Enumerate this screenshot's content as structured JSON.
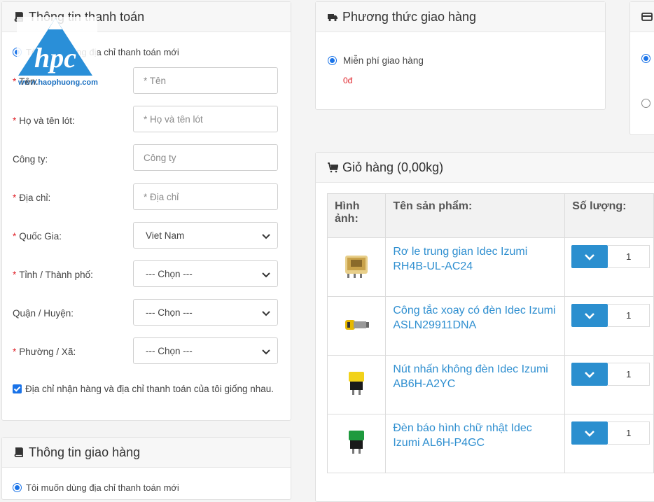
{
  "logo": {
    "text": "hpc",
    "url": "www.haophuong.com"
  },
  "billing": {
    "title": "Thông tin thanh toán",
    "new_address_option": "Tôi muốn dùng địa chỉ thanh toán mới",
    "fields": [
      {
        "label": "Tên:",
        "placeholder": "* Tên",
        "required": true
      },
      {
        "label": "Họ và tên lót:",
        "placeholder": "* Họ và tên lót",
        "required": true
      },
      {
        "label": "Công ty:",
        "placeholder": "Công ty",
        "required": false
      },
      {
        "label": "Địa chỉ:",
        "placeholder": "* Địa chỉ",
        "required": true
      }
    ],
    "selects": [
      {
        "label": "Quốc Gia:",
        "value": "Viet Nam",
        "required": true
      },
      {
        "label": "Tỉnh / Thành phố:",
        "value": "--- Chọn ---",
        "required": true
      },
      {
        "label": "Quận / Huyện:",
        "value": "--- Chọn ---",
        "required": false
      },
      {
        "label": "Phường / Xã:",
        "value": "--- Chọn ---",
        "required": true
      }
    ],
    "same_address_label": "Địa chỉ nhận hàng và địa chỉ thanh toán của tôi giống nhau."
  },
  "shipping_info": {
    "title": "Thông tin giao hàng",
    "option": "Tôi muốn dùng địa chỉ thanh toán mới"
  },
  "shipping_method": {
    "title": "Phương thức giao hàng",
    "option": "Miễn phí giao hàng",
    "price": "0đ"
  },
  "cart": {
    "title": "Giỏ hàng (0,00kg)",
    "headers": {
      "image": "Hình ảnh:",
      "name": "Tên sản phẩm:",
      "qty": "Số lượng:"
    },
    "items": [
      {
        "name": "Rơ le trung gian Idec Izumi RH4B-UL-AC24",
        "qty": "1"
      },
      {
        "name": "Công tắc xoay có đèn Idec Izumi ASLN29911DNA",
        "qty": "1"
      },
      {
        "name": "Nút nhấn không đèn Idec Izumi AB6H-A2YC",
        "qty": "1"
      },
      {
        "name": "Đèn báo hình chữ nhật Idec Izumi AL6H-P4GC",
        "qty": "1"
      }
    ]
  },
  "colors": {
    "accent": "#2b8fcf",
    "link": "#2f8fd0",
    "required": "#e0242b",
    "price": "#e0242b"
  }
}
